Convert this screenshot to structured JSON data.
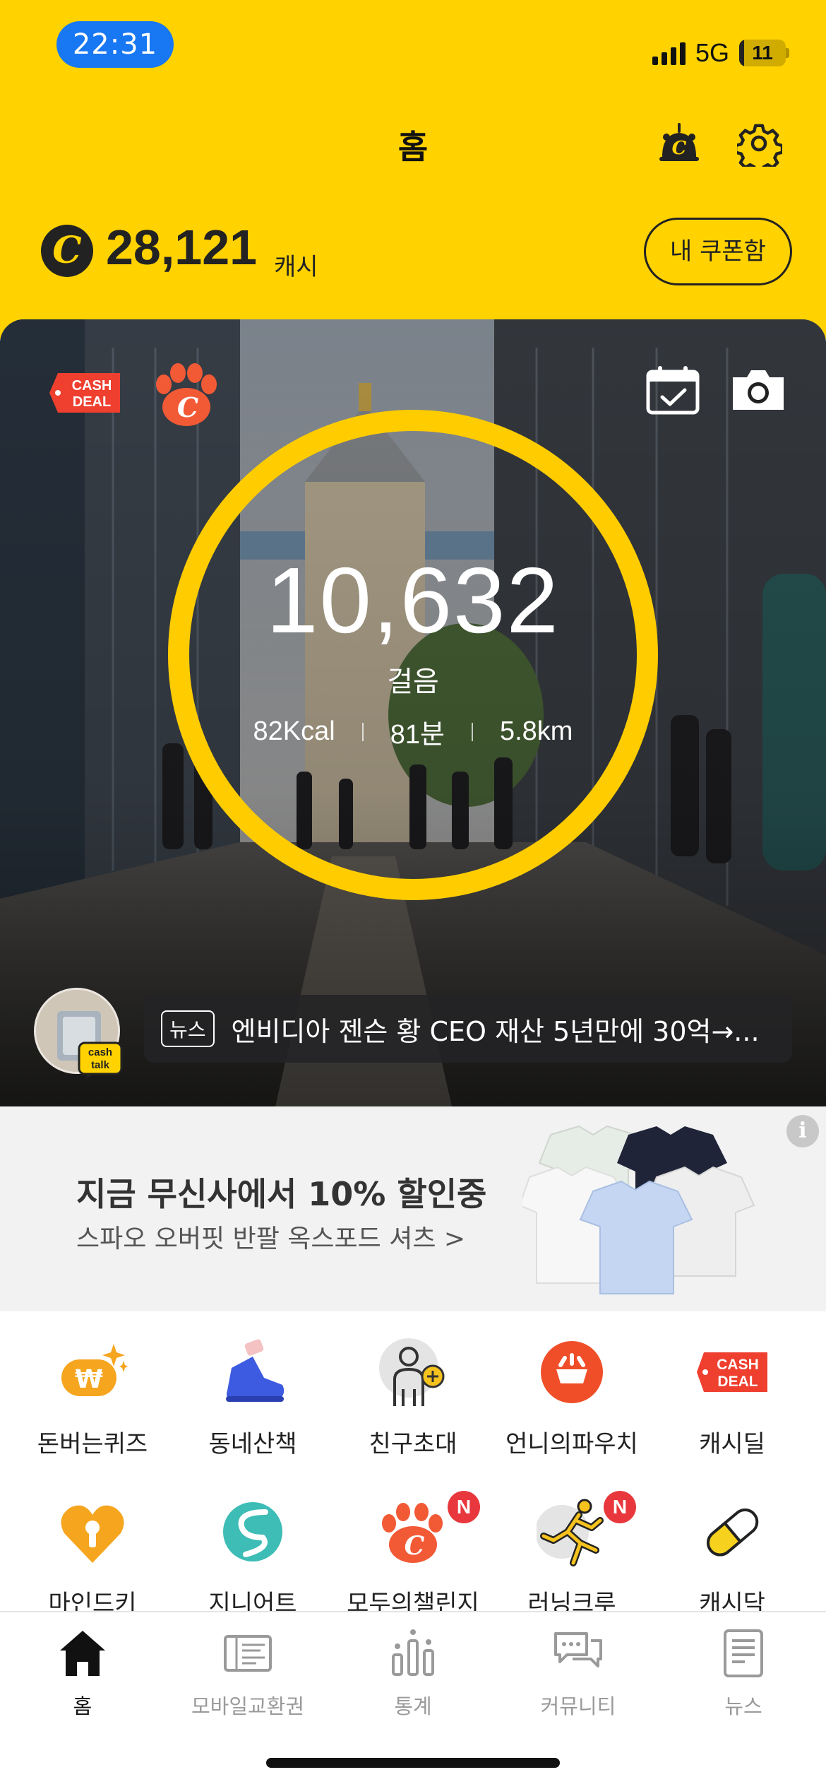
{
  "status_bar": {
    "time": "22:31",
    "network": "5G",
    "battery_level": "11",
    "battery_percent": 11
  },
  "header": {
    "title": "홈",
    "pet_icon": "pet-coin-icon",
    "settings_icon": "gear-icon"
  },
  "cash": {
    "coin_symbol": "C",
    "amount": "28,121",
    "unit": "캐시",
    "coupon_button": "내 쿠폰함"
  },
  "hero": {
    "cashdeal_badge": [
      "CASH",
      "DEAL"
    ],
    "steps": "10,632",
    "steps_label": "걸음",
    "kcal": "82Kcal",
    "minutes": "81분",
    "distance": "5.8km",
    "ring_color": "#FFCC00",
    "news": {
      "tag": "뉴스",
      "headline": "엔비디아 젠슨 황 CEO 재산 5년만에 30억→...",
      "badge_top": "cash",
      "badge_bottom": "talk"
    }
  },
  "ad": {
    "title": "지금 무신사에서 10% 할인중",
    "subtitle": "스파오 오버핏 반팔 옥스포드 셔츠 >",
    "info_icon": "i"
  },
  "menu": {
    "row1": [
      {
        "label": "돈버는퀴즈",
        "icon": "quiz-coin-icon"
      },
      {
        "label": "동네산책",
        "icon": "sneaker-icon"
      },
      {
        "label": "친구초대",
        "icon": "invite-friend-icon"
      },
      {
        "label": "언니의파우치",
        "icon": "pouch-icon"
      },
      {
        "label": "캐시딜",
        "icon": "cashdeal-icon",
        "badge_lines": [
          "CASH",
          "DEAL"
        ]
      }
    ],
    "row2": [
      {
        "label": "마인드키",
        "icon": "heart-lock-icon"
      },
      {
        "label": "지니어트",
        "icon": "s-logo-icon"
      },
      {
        "label": "모두의챌린지",
        "icon": "paw-challenge-icon",
        "badge": "N"
      },
      {
        "label": "러닝크루",
        "icon": "runner-icon",
        "badge": "N"
      },
      {
        "label": "캐시닥",
        "icon": "pill-icon"
      }
    ]
  },
  "tabs": [
    {
      "label": "홈",
      "icon": "home-icon",
      "active": true
    },
    {
      "label": "모바일교환권",
      "icon": "gift-voucher-icon",
      "active": false
    },
    {
      "label": "통계",
      "icon": "statistics-icon",
      "active": false
    },
    {
      "label": "커뮤니티",
      "icon": "community-icon",
      "active": false
    },
    {
      "label": "뉴스",
      "icon": "news-icon",
      "active": false
    }
  ]
}
